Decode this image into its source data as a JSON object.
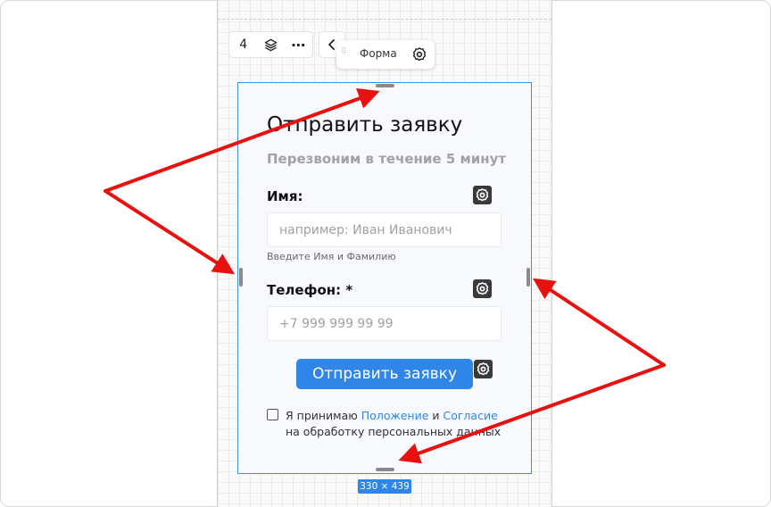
{
  "toolbar": {
    "number": "4",
    "layers_icon": "layers-icon",
    "more_label": "⋯",
    "back_icon": "chevron-left-icon"
  },
  "element_chip": {
    "label": "Форма",
    "settings_icon": "gear-icon"
  },
  "form": {
    "title": "Отправить заявку",
    "subtitle": "Перезвоним в течение 5 минут",
    "name_field": {
      "label": "Имя:",
      "placeholder": "например: Иван Иванович",
      "hint": "Введите Имя и Фамилию"
    },
    "phone_field": {
      "label": "Телефон: *",
      "placeholder": "+7 999 999 99 99"
    },
    "submit_label": "Отправить заявку",
    "consent": {
      "prefix": "Я принимаю ",
      "link1": "Положение",
      "middle": " и ",
      "link2": "Согласие",
      "suffix": " на обработку персональных данных",
      "checked": false
    }
  },
  "size_badge": "330 × 439",
  "colors": {
    "accent": "#2f86e8",
    "annotation_arrow": "#e8110f",
    "gear_button": "#3a3a3a"
  }
}
